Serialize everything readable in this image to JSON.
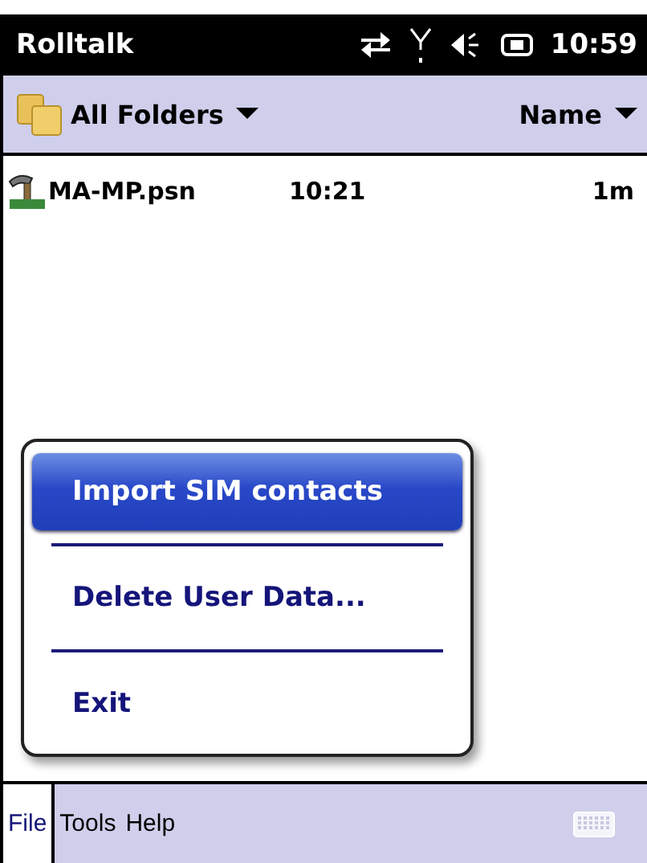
{
  "title_bar": {
    "title": "Rolltalk",
    "time": "10:59"
  },
  "toolbar": {
    "folder": "All Folders",
    "sort": "Name"
  },
  "files": [
    {
      "name": "MA-MP.psn",
      "time": "10:21",
      "size": "1m"
    }
  ],
  "popup_menu": [
    {
      "label": "Import SIM contacts",
      "selected": true
    },
    {
      "label": "Delete User Data...",
      "selected": false
    },
    {
      "label": "Exit",
      "selected": false
    }
  ],
  "menu_bar": [
    {
      "label": "File",
      "selected": true
    },
    {
      "label": "Tools",
      "selected": false
    },
    {
      "label": "Help",
      "selected": false
    }
  ]
}
